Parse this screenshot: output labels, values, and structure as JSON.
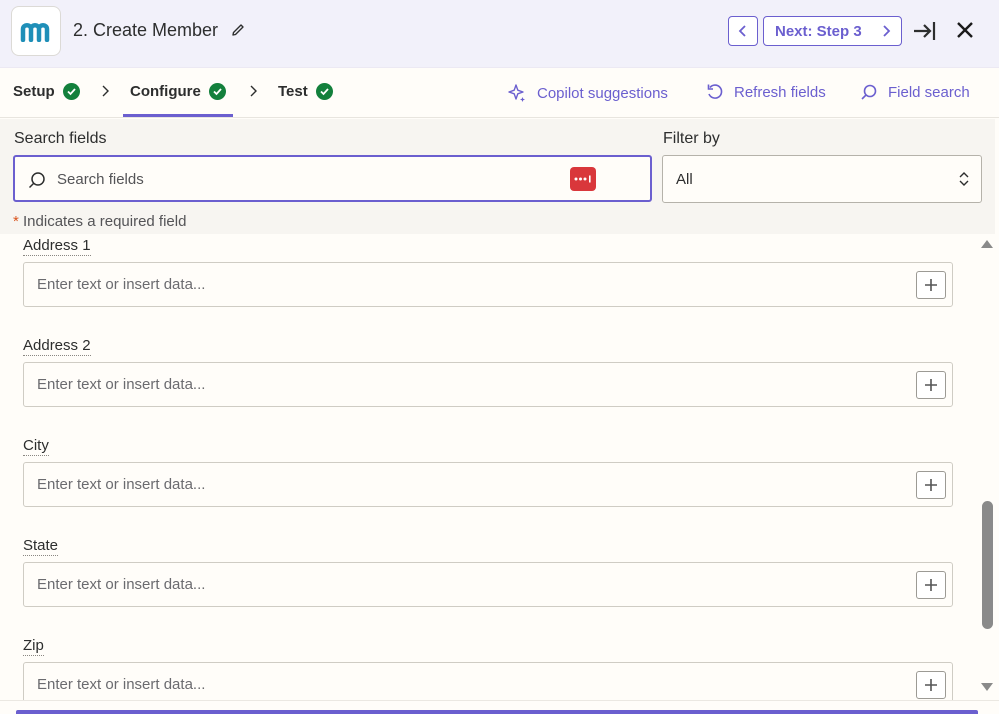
{
  "header": {
    "title": "2. Create Member",
    "next_label": "Next: Step 3",
    "icons": [
      "app-logo",
      "pencil-icon",
      "chevron-left-icon",
      "chevron-right-icon",
      "exit-panel-icon",
      "close-icon"
    ]
  },
  "tabs": [
    {
      "label": "Setup",
      "complete": true
    },
    {
      "label": "Configure",
      "complete": true,
      "active": true
    },
    {
      "label": "Test",
      "complete": true
    }
  ],
  "toolbar": {
    "copilot": "Copilot suggestions",
    "refresh": "Refresh fields",
    "field_search": "Field search"
  },
  "search": {
    "label": "Search fields",
    "placeholder": "Search fields"
  },
  "filter": {
    "label": "Filter by",
    "value": "All"
  },
  "required_note": {
    "star": "*",
    "text": "Indicates a required field"
  },
  "fields": [
    {
      "label": "Address 1",
      "placeholder": "Enter text or insert data..."
    },
    {
      "label": "Address 2",
      "placeholder": "Enter text or insert data..."
    },
    {
      "label": "City",
      "placeholder": "Enter text or insert data..."
    },
    {
      "label": "State",
      "placeholder": "Enter text or insert data..."
    },
    {
      "label": "Zip",
      "placeholder": "Enter text or insert data..."
    }
  ],
  "colors": {
    "accent": "#6b5fcf",
    "success": "#13803c",
    "badge": "#d9373b",
    "header_bg": "#f2f1fa"
  }
}
